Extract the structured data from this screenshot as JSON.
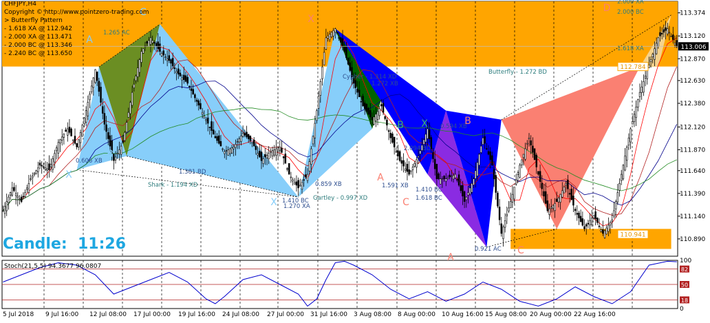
{
  "header": {
    "symbol": "CHFJPY,H4",
    "copyright": "Copyright © http://www.pointzero-trading.com",
    "pattern": "> Butterfly Pattern",
    "lines": [
      "- 1.618 XA @ 112.942",
      "- 2.000 XA @ 113.471",
      "- 2.000 BC @ 113.346",
      "- 2.240 BC @ 113.650"
    ]
  },
  "candle_timer": "Candle:  11:26",
  "colors": {
    "orange_zone": "#ffa500",
    "bull_fill": "#87cefa",
    "bear_fill": "#0000ff",
    "salmon": "#fa8072",
    "wheat": "#f5d28c",
    "olive": "#6b8e23",
    "green": "#006400",
    "purple": "#8a2be2",
    "candle": "#000000",
    "stoch_line": "#0000cd",
    "stoch_level": "#b22222",
    "price_current": "#000000"
  },
  "chart_data": [
    {
      "type": "candlestick",
      "symbol": "CHFJPY",
      "timeframe": "H4",
      "ylim": [
        110.7,
        113.5
      ],
      "y_ticks": [
        "113.374",
        "113.120",
        "112.870",
        "112.630",
        "112.380",
        "112.120",
        "111.870",
        "111.640",
        "111.390",
        "111.140",
        "110.890"
      ],
      "x_ticks": [
        "5 Jul 2018",
        "9 Jul 16:00",
        "12 Jul 08:00",
        "17 Jul 00:00",
        "19 Jul 16:00",
        "24 Jul 08:00",
        "27 Jul 00:00",
        "31 Jul 16:00",
        "3 Aug 08:00",
        "8 Aug 00:00",
        "10 Aug 16:00",
        "15 Aug 08:00",
        "20 Aug 00:00",
        "22 Aug 16:00"
      ],
      "current_price": "113.006",
      "price_tags": [
        {
          "label": "112.784",
          "value": 112.784
        },
        {
          "label": "110.941",
          "value": 110.941
        }
      ],
      "close_path": [
        [
          0,
          111.2
        ],
        [
          5,
          111.45
        ],
        [
          10,
          111.3
        ],
        [
          15,
          111.55
        ],
        [
          20,
          111.7
        ],
        [
          25,
          111.65
        ],
        [
          30,
          111.95
        ],
        [
          35,
          112.1
        ],
        [
          40,
          111.9
        ],
        [
          45,
          112.3
        ],
        [
          50,
          112.75
        ],
        [
          55,
          112.15
        ],
        [
          60,
          111.75
        ],
        [
          65,
          111.95
        ],
        [
          70,
          112.5
        ],
        [
          75,
          112.95
        ],
        [
          80,
          113.1
        ],
        [
          85,
          112.95
        ],
        [
          90,
          112.85
        ],
        [
          95,
          112.7
        ],
        [
          100,
          112.6
        ],
        [
          105,
          112.4
        ],
        [
          110,
          112.2
        ],
        [
          115,
          112.0
        ],
        [
          120,
          111.85
        ],
        [
          125,
          111.9
        ],
        [
          130,
          112.05
        ],
        [
          135,
          111.95
        ],
        [
          140,
          111.75
        ],
        [
          145,
          111.85
        ],
        [
          150,
          111.9
        ],
        [
          155,
          111.6
        ],
        [
          160,
          111.45
        ],
        [
          165,
          111.6
        ],
        [
          170,
          112.3
        ],
        [
          175,
          113.1
        ],
        [
          180,
          113.2
        ],
        [
          185,
          112.95
        ],
        [
          190,
          112.6
        ],
        [
          195,
          112.35
        ],
        [
          200,
          112.2
        ],
        [
          205,
          112.35
        ],
        [
          210,
          112.0
        ],
        [
          215,
          111.75
        ],
        [
          220,
          111.6
        ],
        [
          225,
          111.8
        ],
        [
          230,
          112.1
        ],
        [
          235,
          111.55
        ],
        [
          240,
          111.55
        ],
        [
          245,
          111.6
        ],
        [
          250,
          111.3
        ],
        [
          255,
          111.55
        ],
        [
          260,
          112.0
        ],
        [
          265,
          111.7
        ],
        [
          270,
          110.95
        ],
        [
          275,
          111.3
        ],
        [
          280,
          111.7
        ],
        [
          285,
          112.0
        ],
        [
          290,
          111.6
        ],
        [
          295,
          111.2
        ],
        [
          300,
          111.3
        ],
        [
          305,
          111.5
        ],
        [
          310,
          111.2
        ],
        [
          315,
          111.0
        ],
        [
          320,
          111.15
        ],
        [
          325,
          110.95
        ],
        [
          330,
          111.1
        ],
        [
          335,
          111.6
        ],
        [
          340,
          112.1
        ],
        [
          345,
          112.5
        ],
        [
          350,
          112.8
        ],
        [
          355,
          113.1
        ],
        [
          360,
          113.2
        ],
        [
          365,
          113.0
        ]
      ],
      "patterns": [
        {
          "name": "Butterfly",
          "label": "Butterfly - 1.272 BD",
          "points": {
            "X": 111.2,
            "A": 112.8,
            "B": 111.75,
            "C": 113.27,
            "D": 111.28
          }
        },
        {
          "name": "Shark",
          "label": "Shark - 1.194 XD"
        },
        {
          "name": "Gartley",
          "label": "Gartley - 0.997 XD"
        },
        {
          "name": "Cypher",
          "label": "Cypher - 1.314 XD"
        },
        {
          "name": "Butterfly",
          "label": "Butterfly - 1.272 BD"
        }
      ],
      "ratio_labels": [
        "0.606 XB",
        "1.265 AC",
        "1.381 BD",
        "1.270 XA",
        "1.410 BC",
        "0.859 XB",
        "1.591 XB",
        "1.410 BC",
        "1.618 BC",
        "2.094 BD",
        "0.594 XB",
        "0.921 AC",
        "1.618 XA",
        "2.000 BC",
        "2.000 XA",
        "1.272 XB"
      ],
      "point_labels": [
        "X",
        "A",
        "B",
        "C",
        "D"
      ]
    },
    {
      "type": "line",
      "name": "Stoch(21,5,5)",
      "legend": "Stoch(21,5,5) 94.3677 96.0807",
      "values": [
        94.3677,
        96.0807
      ],
      "ylim": [
        0,
        100
      ],
      "levels": [
        "82",
        "50",
        "18"
      ],
      "y_ticks": [
        "100",
        "0"
      ],
      "path": [
        [
          0,
          55
        ],
        [
          10,
          70
        ],
        [
          20,
          85
        ],
        [
          30,
          95
        ],
        [
          40,
          90
        ],
        [
          50,
          70
        ],
        [
          60,
          30
        ],
        [
          70,
          45
        ],
        [
          80,
          60
        ],
        [
          90,
          75
        ],
        [
          100,
          55
        ],
        [
          110,
          20
        ],
        [
          115,
          10
        ],
        [
          120,
          25
        ],
        [
          130,
          60
        ],
        [
          140,
          70
        ],
        [
          150,
          50
        ],
        [
          160,
          30
        ],
        [
          165,
          5
        ],
        [
          170,
          20
        ],
        [
          175,
          60
        ],
        [
          180,
          95
        ],
        [
          185,
          98
        ],
        [
          190,
          90
        ],
        [
          200,
          70
        ],
        [
          210,
          40
        ],
        [
          220,
          20
        ],
        [
          230,
          35
        ],
        [
          240,
          15
        ],
        [
          250,
          30
        ],
        [
          260,
          55
        ],
        [
          270,
          40
        ],
        [
          280,
          15
        ],
        [
          290,
          5
        ],
        [
          300,
          20
        ],
        [
          310,
          45
        ],
        [
          320,
          25
        ],
        [
          330,
          10
        ],
        [
          340,
          35
        ],
        [
          350,
          90
        ],
        [
          360,
          98
        ],
        [
          365,
          97
        ]
      ]
    }
  ]
}
